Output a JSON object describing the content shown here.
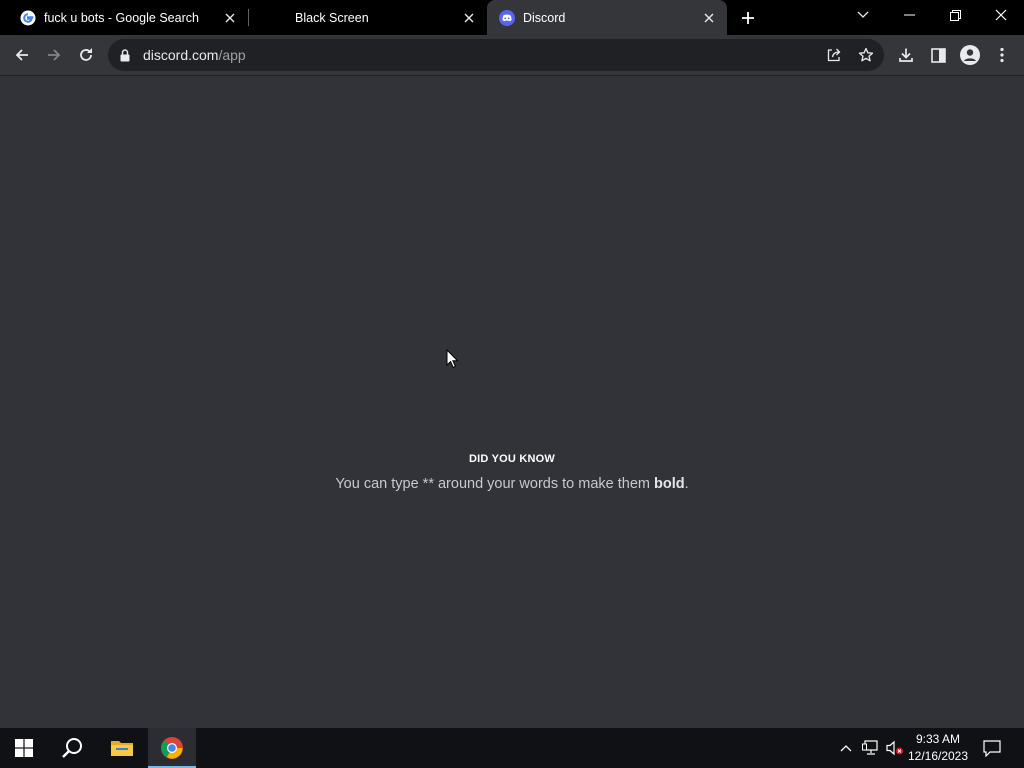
{
  "browser": {
    "tabs": [
      {
        "title": "fuck u bots - Google Search",
        "favicon": "google-icon",
        "active": false
      },
      {
        "title": "Black Screen",
        "favicon": "",
        "active": false
      },
      {
        "title": "Discord",
        "favicon": "discord-icon",
        "active": true
      }
    ],
    "address": {
      "domain": "discord.com",
      "path": "/app"
    }
  },
  "page": {
    "tip_heading": "DID YOU KNOW",
    "tip_text_before": "You can type ** around your words to make them ",
    "tip_text_bold": "bold",
    "tip_text_after": ".",
    "background_color": "#313338"
  },
  "taskbar": {
    "time": "9:33 AM",
    "date": "12/16/2023",
    "items": [
      "start-icon",
      "search-icon",
      "file-explorer-icon",
      "chrome-icon"
    ]
  }
}
